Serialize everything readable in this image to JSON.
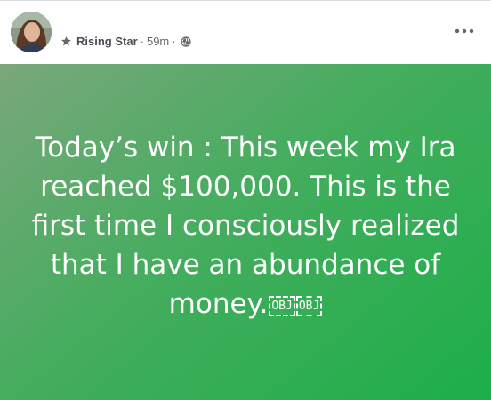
{
  "post": {
    "author_badge": "Rising Star",
    "separator": "·",
    "time": "59m",
    "audience_icon": "globe-icon",
    "badge_icon": "star-icon",
    "more_icon": "more-horizontal-icon",
    "text": "Today’s win : This week my Ira reached $100,000. This is the first time I consciously realized that I have an abundance of money.",
    "trailing_glyphs": [
      "OBJ",
      "OBJ"
    ],
    "background_colors": [
      "#7aa77c",
      "#1cae49"
    ]
  }
}
